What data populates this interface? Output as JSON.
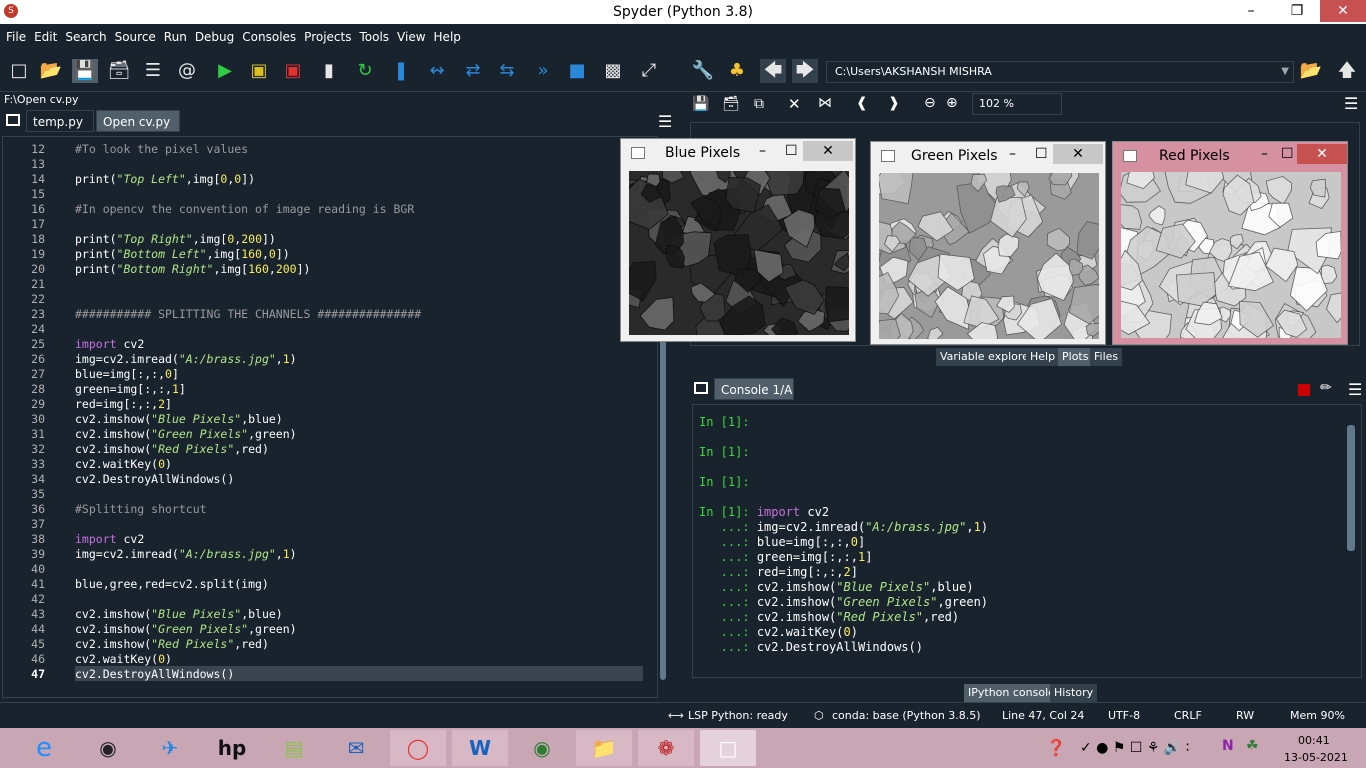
{
  "window": {
    "title": "Spyder (Python 3.8)",
    "min": "–",
    "max": "❐",
    "close": "✕"
  },
  "menu": [
    "File",
    "Edit",
    "Search",
    "Source",
    "Run",
    "Debug",
    "Consoles",
    "Projects",
    "Tools",
    "View",
    "Help"
  ],
  "toolbar": {
    "path": "C:\\Users\\AKSHANSH MISHRA",
    "zoom": "102 %"
  },
  "editor": {
    "filepath": "F:\\Open cv.py",
    "tabs": [
      {
        "label": "temp.py",
        "close": "✕"
      },
      {
        "label": "Open cv.py",
        "close": "✕"
      }
    ],
    "lines": [
      {
        "n": "12",
        "t": [
          {
            "c": "cm",
            "s": "#To look the pixel values"
          }
        ]
      },
      {
        "n": "13",
        "t": []
      },
      {
        "n": "14",
        "t": [
          {
            "c": "",
            "s": "print("
          },
          {
            "c": "str",
            "s": "\"Top Left\""
          },
          {
            "c": "",
            "s": ",img["
          },
          {
            "c": "num",
            "s": "0"
          },
          {
            "c": "",
            "s": ","
          },
          {
            "c": "num",
            "s": "0"
          },
          {
            "c": "",
            "s": "])"
          }
        ]
      },
      {
        "n": "15",
        "t": []
      },
      {
        "n": "16",
        "t": [
          {
            "c": "cm",
            "s": "#In opencv the convention of image reading is BGR"
          }
        ]
      },
      {
        "n": "17",
        "t": []
      },
      {
        "n": "18",
        "t": [
          {
            "c": "",
            "s": "print("
          },
          {
            "c": "str",
            "s": "\"Top Right\""
          },
          {
            "c": "",
            "s": ",img["
          },
          {
            "c": "num",
            "s": "0"
          },
          {
            "c": "",
            "s": ","
          },
          {
            "c": "num",
            "s": "200"
          },
          {
            "c": "",
            "s": "])"
          }
        ]
      },
      {
        "n": "19",
        "t": [
          {
            "c": "",
            "s": "print("
          },
          {
            "c": "str",
            "s": "\"Bottom Left\""
          },
          {
            "c": "",
            "s": ",img["
          },
          {
            "c": "num",
            "s": "160"
          },
          {
            "c": "",
            "s": ","
          },
          {
            "c": "num",
            "s": "0"
          },
          {
            "c": "",
            "s": "])"
          }
        ]
      },
      {
        "n": "20",
        "t": [
          {
            "c": "",
            "s": "print("
          },
          {
            "c": "str",
            "s": "\"Bottom Right\""
          },
          {
            "c": "",
            "s": ",img["
          },
          {
            "c": "num",
            "s": "160"
          },
          {
            "c": "",
            "s": ","
          },
          {
            "c": "num",
            "s": "200"
          },
          {
            "c": "",
            "s": "])"
          }
        ]
      },
      {
        "n": "21",
        "t": []
      },
      {
        "n": "22",
        "t": []
      },
      {
        "n": "23",
        "t": [
          {
            "c": "cm",
            "s": "########### SPLITTING THE CHANNELS ###############"
          }
        ]
      },
      {
        "n": "24",
        "t": []
      },
      {
        "n": "25",
        "t": [
          {
            "c": "kw",
            "s": "import"
          },
          {
            "c": "",
            "s": " cv2"
          }
        ]
      },
      {
        "n": "26",
        "t": [
          {
            "c": "",
            "s": "img=cv2.imread("
          },
          {
            "c": "str",
            "s": "\"A:/brass.jpg\""
          },
          {
            "c": "",
            "s": ","
          },
          {
            "c": "num",
            "s": "1"
          },
          {
            "c": "",
            "s": ")"
          }
        ]
      },
      {
        "n": "27",
        "t": [
          {
            "c": "",
            "s": "blue=img[:,:,"
          },
          {
            "c": "num",
            "s": "0"
          },
          {
            "c": "",
            "s": "]"
          }
        ]
      },
      {
        "n": "28",
        "t": [
          {
            "c": "",
            "s": "green=img[:,:,"
          },
          {
            "c": "num",
            "s": "1"
          },
          {
            "c": "",
            "s": "]"
          }
        ]
      },
      {
        "n": "29",
        "t": [
          {
            "c": "",
            "s": "red=img[:,:,"
          },
          {
            "c": "num",
            "s": "2"
          },
          {
            "c": "",
            "s": "]"
          }
        ]
      },
      {
        "n": "30",
        "t": [
          {
            "c": "",
            "s": "cv2.imshow("
          },
          {
            "c": "str",
            "s": "\"Blue Pixels\""
          },
          {
            "c": "",
            "s": ",blue)"
          }
        ]
      },
      {
        "n": "31",
        "t": [
          {
            "c": "",
            "s": "cv2.imshow("
          },
          {
            "c": "str",
            "s": "\"Green Pixels\""
          },
          {
            "c": "",
            "s": ",green)"
          }
        ]
      },
      {
        "n": "32",
        "t": [
          {
            "c": "",
            "s": "cv2.imshow("
          },
          {
            "c": "str",
            "s": "\"Red Pixels\""
          },
          {
            "c": "",
            "s": ",red)"
          }
        ]
      },
      {
        "n": "33",
        "t": [
          {
            "c": "",
            "s": "cv2.waitKey("
          },
          {
            "c": "num",
            "s": "0"
          },
          {
            "c": "",
            "s": ")"
          }
        ]
      },
      {
        "n": "34",
        "t": [
          {
            "c": "",
            "s": "cv2.DestroyAllWindows()"
          }
        ]
      },
      {
        "n": "35",
        "t": []
      },
      {
        "n": "36",
        "t": [
          {
            "c": "cm",
            "s": "#Splitting shortcut"
          }
        ]
      },
      {
        "n": "37",
        "t": []
      },
      {
        "n": "38",
        "t": [
          {
            "c": "kw",
            "s": "import"
          },
          {
            "c": "",
            "s": " cv2"
          }
        ]
      },
      {
        "n": "39",
        "t": [
          {
            "c": "",
            "s": "img=cv2.imread("
          },
          {
            "c": "str",
            "s": "\"A:/brass.jpg\""
          },
          {
            "c": "",
            "s": ","
          },
          {
            "c": "num",
            "s": "1"
          },
          {
            "c": "",
            "s": ")"
          }
        ]
      },
      {
        "n": "40",
        "t": []
      },
      {
        "n": "41",
        "t": [
          {
            "c": "",
            "s": "blue,gree,red=cv2.split(img)"
          }
        ]
      },
      {
        "n": "42",
        "t": []
      },
      {
        "n": "43",
        "t": [
          {
            "c": "",
            "s": "cv2.imshow("
          },
          {
            "c": "str",
            "s": "\"Blue Pixels\""
          },
          {
            "c": "",
            "s": ",blue)"
          }
        ]
      },
      {
        "n": "44",
        "t": [
          {
            "c": "",
            "s": "cv2.imshow("
          },
          {
            "c": "str",
            "s": "\"Green Pixels\""
          },
          {
            "c": "",
            "s": ",green)"
          }
        ]
      },
      {
        "n": "45",
        "t": [
          {
            "c": "",
            "s": "cv2.imshow("
          },
          {
            "c": "str",
            "s": "\"Red Pixels\""
          },
          {
            "c": "",
            "s": ",red)"
          }
        ]
      },
      {
        "n": "46",
        "t": [
          {
            "c": "",
            "s": "cv2.waitKey("
          },
          {
            "c": "num",
            "s": "0"
          },
          {
            "c": "",
            "s": ")"
          }
        ]
      },
      {
        "n": "47",
        "t": [
          {
            "c": "",
            "s": "cv2.DestroyAllWindows()"
          }
        ]
      }
    ]
  },
  "image_windows": [
    {
      "title": "Blue Pixels",
      "tone": "#2a2a2a",
      "tone2": "#7a7a7a"
    },
    {
      "title": "Green Pixels",
      "tone": "#9a9a9a",
      "tone2": "#e6e6e6"
    },
    {
      "title": "Red Pixels",
      "tone": "#c8c8c8",
      "tone2": "#ffffff"
    }
  ],
  "plots_pane": {
    "tabs": [
      "Variable explorer",
      "Help",
      "Plots",
      "Files"
    ]
  },
  "console": {
    "tab": "Console 1/A",
    "lines": [
      {
        "p": "In [1]:",
        "code": ""
      },
      {
        "p": "",
        "code": ""
      },
      {
        "p": "In [1]:",
        "code": ""
      },
      {
        "p": "",
        "code": ""
      },
      {
        "p": "In [1]:",
        "code": ""
      },
      {
        "p": "",
        "code": ""
      },
      {
        "p": "In [1]:",
        "code": "import cv2"
      },
      {
        "p": "   ...:",
        "code": "img=cv2.imread(\"A:/brass.jpg\",1)"
      },
      {
        "p": "   ...:",
        "code": "blue=img[:,:,0]"
      },
      {
        "p": "   ...:",
        "code": "green=img[:,:,1]"
      },
      {
        "p": "   ...:",
        "code": "red=img[:,:,2]"
      },
      {
        "p": "   ...:",
        "code": "cv2.imshow(\"Blue Pixels\",blue)"
      },
      {
        "p": "   ...:",
        "code": "cv2.imshow(\"Green Pixels\",green)"
      },
      {
        "p": "   ...:",
        "code": "cv2.imshow(\"Red Pixels\",red)"
      },
      {
        "p": "   ...:",
        "code": "cv2.waitKey(0)"
      },
      {
        "p": "   ...:",
        "code": "cv2.DestroyAllWindows()"
      }
    ],
    "bottom_tabs": [
      "IPython console",
      "History"
    ]
  },
  "status": {
    "lsp": "LSP Python: ready",
    "conda": "conda: base (Python 3.8.5)",
    "pos": "Line 47, Col 24",
    "enc": "UTF-8",
    "eol": "CRLF",
    "rw": "RW",
    "mem": "Mem 90%"
  },
  "tray": {
    "time": "00:41",
    "date": "13-05-2021"
  }
}
